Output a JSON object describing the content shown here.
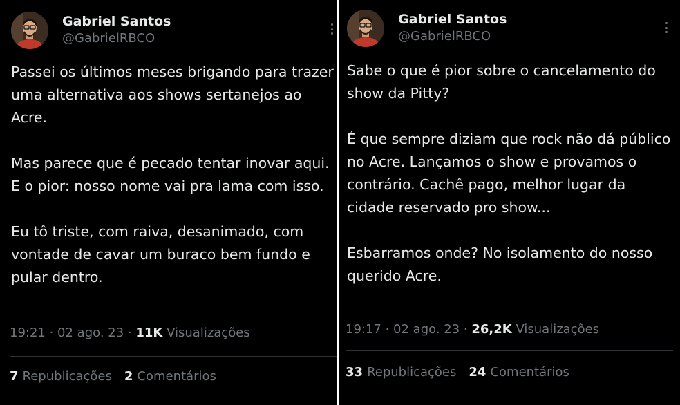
{
  "tweets": [
    {
      "author_name": "Gabriel Santos",
      "author_handle": "@GabrielRBCO",
      "paragraphs": [
        "Passei os últimos meses brigando para trazer uma alternativa aos shows sertanejos ao Acre.",
        "Mas parece que é pecado tentar inovar aqui. E o pior: nosso nome vai pra lama com isso.",
        "Eu tô triste, com raiva, desanimado, com vontade de cavar um buraco bem fundo e pular dentro."
      ],
      "time": "19:21",
      "date": "02 ago. 23",
      "views_count": "11K",
      "views_label": "Visualizações",
      "reposts_count": "7",
      "reposts_label": "Republicações",
      "comments_count": "2",
      "comments_label": "Comentários"
    },
    {
      "author_name": "Gabriel Santos",
      "author_handle": "@GabrielRBCO",
      "paragraphs": [
        "Sabe o que é pior sobre o cancelamento do show da Pitty?",
        "É que sempre diziam que rock não dá público no Acre. Lançamos o show e provamos o contrário. Cachê pago, melhor lugar da cidade reservado pro show...",
        "Esbarramos onde? No isolamento do nosso querido Acre."
      ],
      "time": "19:17",
      "date": "02 ago. 23",
      "views_count": "26,2K",
      "views_label": "Visualizações",
      "reposts_count": "33",
      "reposts_label": "Republicações",
      "comments_count": "24",
      "comments_label": "Comentários"
    }
  ],
  "separator": " · ",
  "colors": {
    "background": "#000000",
    "text_primary": "#e7e9ea",
    "text_secondary": "#71767b",
    "divider": "#2f3336",
    "avatar_shirt": "#c0392b"
  },
  "icons": [
    "more-icon"
  ]
}
